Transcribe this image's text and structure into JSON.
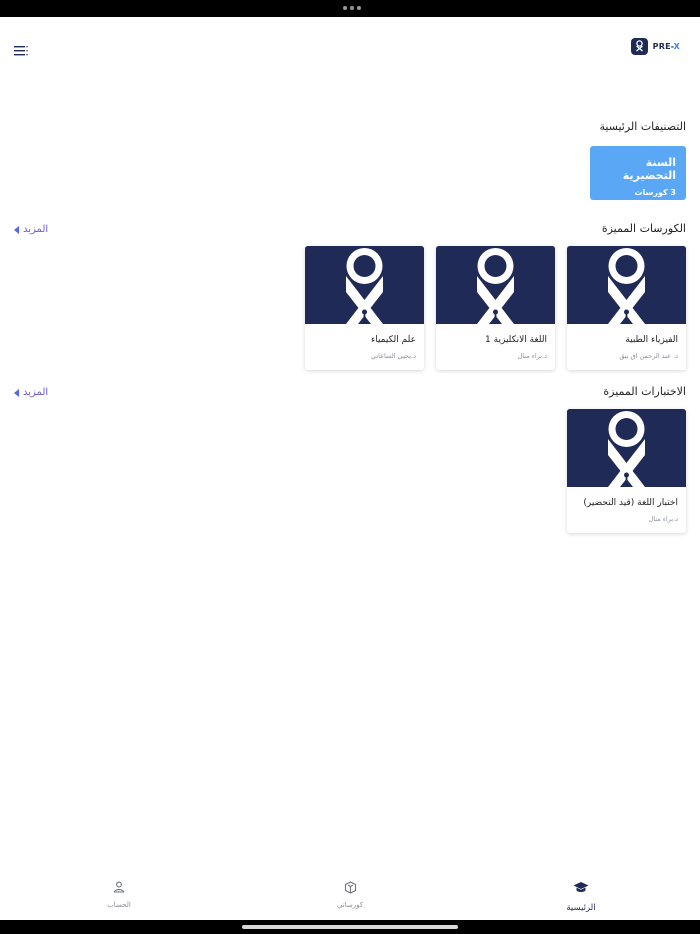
{
  "header": {
    "logo_text": "PRE-",
    "logo_text_accent": "X"
  },
  "categories": {
    "title": "التصنيفات الرئيسية",
    "items": [
      {
        "title": "السنة التحضيرية",
        "count": "3 كورسات"
      }
    ]
  },
  "featured_courses": {
    "title": "الكورسات المميزة",
    "more_label": "المزيد",
    "items": [
      {
        "title": "الفيزياء الطبية",
        "author": "د. عبد الرحمن اق بيق"
      },
      {
        "title": "اللغة الانكليزية 1",
        "author": "د.براء منال"
      },
      {
        "title": "علم الكيمياء",
        "author": "د.يحيى الساعاتي"
      }
    ]
  },
  "featured_exams": {
    "title": "الاختبارات المميزة",
    "more_label": "المزيد",
    "items": [
      {
        "title": "اختبار اللغة (قيد التحضير)",
        "author": "د.براء منال"
      }
    ]
  },
  "bottom_nav": {
    "items": [
      {
        "label": "الحساب",
        "icon": "person-icon",
        "active": false
      },
      {
        "label": "كورساتي",
        "icon": "book-icon",
        "active": false
      },
      {
        "label": "الرئيسية",
        "icon": "graduation-cap-icon",
        "active": true
      }
    ]
  },
  "colors": {
    "brand_navy": "#1f2b56",
    "category_blue": "#5aa8f5",
    "link_purple": "#6b5bd6"
  }
}
